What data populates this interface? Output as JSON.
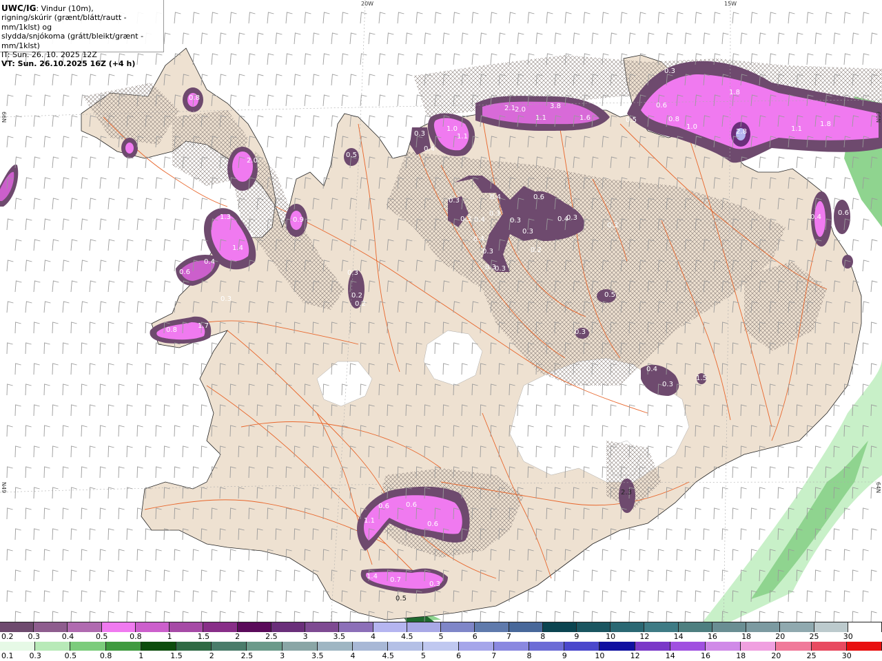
{
  "header": {
    "product": "UWC/IG",
    "line1_rest": ": Vindur (10m),",
    "line2": "rigning/skúrir (grænt/blátt/rautt - mm/1klst) og",
    "line3": "slydda/snjókoma (grátt/bleikt/grænt - mm/1klst)",
    "init_time": "IT: Sun. 26. 10. 2025 12Z",
    "valid_time": "VT: Sun. 26.10.2025 16Z (+4 h)"
  },
  "grid_labels": {
    "top_20w": "20W",
    "top_15w": "15W",
    "left_66n": "66N",
    "left_64n": "N49",
    "right_66n": "66N",
    "right_64n": "64N"
  },
  "colors": {
    "land": "#eee1d1",
    "sea": "#ffffff",
    "roads": "#e8652a",
    "hatch": "#8a7f7a",
    "wind_barb": "#9a9a9a"
  },
  "precip_labels": [
    {
      "text": "0.3",
      "kind": "snow"
    },
    {
      "text": "1.8",
      "kind": "snow"
    },
    {
      "text": "0.6",
      "kind": "snow"
    },
    {
      "text": "0.8",
      "kind": "snow"
    },
    {
      "text": "1.0",
      "kind": "snow"
    },
    {
      "text": "2.8",
      "kind": "snow"
    },
    {
      "text": "1.1",
      "kind": "snow"
    },
    {
      "text": "1.8",
      "kind": "snow"
    },
    {
      "text": "0.5",
      "kind": "snow"
    },
    {
      "text": "2.0",
      "kind": "snow"
    },
    {
      "text": "2.1",
      "kind": "snow"
    },
    {
      "text": "3.8",
      "kind": "snow"
    },
    {
      "text": "1.1",
      "kind": "snow"
    },
    {
      "text": "1.6",
      "kind": "snow"
    },
    {
      "text": "1.0",
      "kind": "snow"
    },
    {
      "text": "1.1",
      "kind": "snow"
    },
    {
      "text": "0.3",
      "kind": "snow"
    },
    {
      "text": "0.4",
      "kind": "snow"
    },
    {
      "text": "0.8",
      "kind": "snow"
    },
    {
      "text": "2.0",
      "kind": "snow"
    },
    {
      "text": "0.5",
      "kind": "snow"
    },
    {
      "text": "1.3",
      "kind": "snow"
    },
    {
      "text": "1.4",
      "kind": "snow"
    },
    {
      "text": "0.9",
      "kind": "snow"
    },
    {
      "text": "0.4",
      "kind": "snow"
    },
    {
      "text": "0.6",
      "kind": "snow"
    },
    {
      "text": "0.3",
      "kind": "snow"
    },
    {
      "text": "0.8",
      "kind": "snow"
    },
    {
      "text": "1.7",
      "kind": "snow"
    },
    {
      "text": "0.3",
      "kind": "snow"
    },
    {
      "text": "0.2",
      "kind": "snow"
    },
    {
      "text": "0.2",
      "kind": "snow"
    },
    {
      "text": "0.4",
      "kind": "snow"
    },
    {
      "text": "0.3",
      "kind": "snow"
    },
    {
      "text": "0.3",
      "kind": "snow"
    },
    {
      "text": "0.3",
      "kind": "snow"
    },
    {
      "text": "0.4",
      "kind": "snow"
    },
    {
      "text": "0.4",
      "kind": "snow"
    },
    {
      "text": "0.6",
      "kind": "snow"
    },
    {
      "text": "0.3",
      "kind": "snow"
    },
    {
      "text": "0.3",
      "kind": "snow"
    },
    {
      "text": "0.3",
      "kind": "snow"
    },
    {
      "text": "0.4",
      "kind": "snow"
    },
    {
      "text": "0.3",
      "kind": "snow"
    },
    {
      "text": "0.2",
      "kind": "snow"
    },
    {
      "text": "0.3",
      "kind": "snow"
    },
    {
      "text": "0.3",
      "kind": "snow"
    },
    {
      "text": "0.3",
      "kind": "snow"
    },
    {
      "text": "0.5",
      "kind": "snow"
    },
    {
      "text": "0.3",
      "kind": "snow"
    },
    {
      "text": "0.4",
      "kind": "snow"
    },
    {
      "text": "0.3",
      "kind": "snow"
    },
    {
      "text": "1.5",
      "kind": "snow"
    },
    {
      "text": "0.4",
      "kind": "snow"
    },
    {
      "text": "0.6",
      "kind": "snow"
    },
    {
      "text": "0.6",
      "kind": "snow"
    },
    {
      "text": "0.6",
      "kind": "snow"
    },
    {
      "text": "1.1",
      "kind": "snow"
    },
    {
      "text": "0.6",
      "kind": "snow"
    },
    {
      "text": "1.4",
      "kind": "snow"
    },
    {
      "text": "0.7",
      "kind": "snow"
    },
    {
      "text": "0.3",
      "kind": "snow"
    },
    {
      "text": "2.3",
      "kind": "rain"
    },
    {
      "text": "0.5",
      "kind": "rain"
    }
  ],
  "legend": {
    "snow_labels": [
      "0.2",
      "0.3",
      "0.4",
      "0.5",
      "0.8",
      "1",
      "1.5",
      "2",
      "2.5",
      "3",
      "3.5",
      "4",
      "4.5",
      "5",
      "6",
      "7",
      "8",
      "9",
      "10",
      "12",
      "14",
      "16",
      "18",
      "20",
      "25",
      "30"
    ],
    "snow_colors": [
      "#6e4a6e",
      "#8e5d8e",
      "#b06ab0",
      "#f07af0",
      "#cc5fcc",
      "#a64aa6",
      "#882e88",
      "#5a0a5a",
      "#6a2f7a",
      "#7e4a92",
      "#8c6fb8",
      "#b5b5f0",
      "#a9a9e6",
      "#7f86c8",
      "#5f7aac",
      "#48689a",
      "#0b4450",
      "#1a5560",
      "#2b6873",
      "#3f7b85",
      "#4e7f80",
      "#6a8e93",
      "#7c9aa1",
      "#90a9af",
      "#bccacd",
      "#ffffff"
    ],
    "rain_labels": [
      "0.1",
      "0.3",
      "0.5",
      "0.8",
      "1",
      "1.5",
      "2",
      "2.5",
      "3",
      "3.5",
      "4",
      "4.5",
      "5",
      "6",
      "7",
      "8",
      "9",
      "10",
      "12",
      "14",
      "16",
      "18",
      "20",
      "25",
      "30"
    ],
    "rain_colors": [
      "#e6f9e6",
      "#b8eab8",
      "#7ccc7c",
      "#3f9a3f",
      "#0d4d0d",
      "#2f6a44",
      "#4a7c6a",
      "#6b9a8a",
      "#8aa6a6",
      "#9fb6c3",
      "#a8b8d6",
      "#b4c0e6",
      "#c0c8f0",
      "#a6a6ea",
      "#8a88e0",
      "#6c6cd6",
      "#4a48cc",
      "#1010a0",
      "#7a38c8",
      "#a050e0",
      "#d08ae8",
      "#f0a0e0",
      "#f07a9a",
      "#e84a60",
      "#e81010"
    ]
  }
}
